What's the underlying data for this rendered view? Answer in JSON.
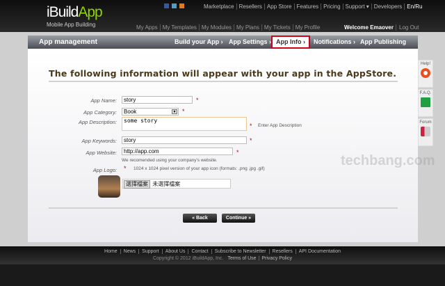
{
  "brand": {
    "logo_a": "iBuild",
    "logo_b": "App",
    "tagline": "Mobile App Building"
  },
  "social_icons": [
    "facebook-icon",
    "twitter-icon",
    "rss-icon"
  ],
  "top_links": [
    "Marketplace",
    "Resellers",
    "App Store",
    "Features",
    "Pricing",
    "Support ▾",
    "Developers",
    "En/Ru"
  ],
  "my_links": [
    "My Apps",
    "My Templates",
    "My Modules",
    "My Plans",
    "My Tickets",
    "My Profile"
  ],
  "user": {
    "welcome": "Welcome Emaover",
    "logout": "Log Out"
  },
  "nav": {
    "title": "App management",
    "steps": [
      "Build your App ›",
      "App Settings ›",
      "App Info ›",
      "Notifications ›",
      "App Publishing"
    ],
    "active": "App Info ›",
    "active_color": "#d0021b"
  },
  "form": {
    "heading": "The following information will appear with your app in the AppStore.",
    "name_label": "App Name:",
    "name": "story",
    "category_label": "App Category:",
    "category": "Book",
    "description_label": "App Description:",
    "description": "some story",
    "description_hint": "Enter App Description",
    "keywords_label": "App Keywords:",
    "keywords": "story",
    "website_label": "App Website:",
    "website": "http://app.com",
    "website_hint": "We recomended using your company's website.",
    "logo_label": "App Logo:",
    "logo_hint": "1024 x 1024 pixel version of your app icon (formats: .png .jpg .gif)",
    "file_button": "選擇檔案",
    "file_status": "未選擇檔案",
    "required_mark": "*",
    "back": "« Back",
    "continue": "Continue »"
  },
  "side": [
    {
      "label": "Help!",
      "icon": "lifebuoy-icon"
    },
    {
      "label": "F.A.Q.",
      "icon": "book-icon"
    },
    {
      "label": "Forum",
      "icon": "megaphone-icon"
    }
  ],
  "watermark": "techbang.com",
  "footer": {
    "links": [
      "Home",
      "News",
      "Support",
      "About Us",
      "Contact",
      "Subscribe to Newsletter",
      "Resellers",
      "API Documentation"
    ],
    "copyright": "Copyright © 2012 iBuildApp, Inc.",
    "terms": "Terms of Use",
    "privacy": "Privacy Policy"
  }
}
